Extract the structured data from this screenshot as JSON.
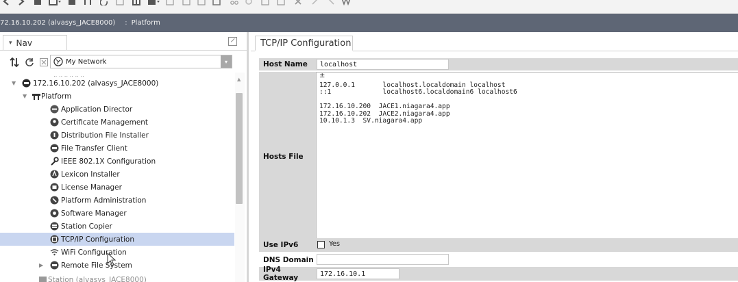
{
  "toolbar": {
    "icons": [
      "back-arrow-icon",
      "forward-arrow-icon",
      "home-icon",
      "grid-dropdown-icon",
      "save-icon",
      "hierarchy-icon",
      "refresh-icon",
      "history-icon",
      "table-icon",
      "menu-dropdown-icon",
      "blank-page-icon",
      "copy-icon",
      "paste-icon",
      "edit-icon",
      "cut-icon",
      "undo-icon",
      "new-icon",
      "duplicate-icon",
      "delete-icon",
      "redo-icon",
      "pointer-icon",
      "wand-icon"
    ]
  },
  "pathbar": {
    "host": "72.16.10.202 (alvasys_JACE8000)",
    "separator": ":",
    "section": "Platform"
  },
  "nav": {
    "title": "Nav",
    "network_select": "My Network",
    "tree": [
      {
        "label": "172.16.10.202 (alvasys_JACE8000)",
        "icon": "server-icon",
        "level": 0,
        "expanded": true
      },
      {
        "label": "Platform",
        "icon": "platform-icon",
        "level": 1,
        "expanded": true
      },
      {
        "label": "Application Director",
        "icon": "application-director-icon",
        "level": 2
      },
      {
        "label": "Certificate Management",
        "icon": "certificate-icon",
        "level": 2
      },
      {
        "label": "Distribution File Installer",
        "icon": "distribution-installer-icon",
        "level": 2
      },
      {
        "label": "File Transfer Client",
        "icon": "file-transfer-icon",
        "level": 2
      },
      {
        "label": "IEEE 802.1X Configuration",
        "icon": "wrench-icon",
        "level": 2
      },
      {
        "label": "Lexicon Installer",
        "icon": "lexicon-icon",
        "level": 2
      },
      {
        "label": "License Manager",
        "icon": "license-icon",
        "level": 2
      },
      {
        "label": "Platform Administration",
        "icon": "platform-admin-icon",
        "level": 2
      },
      {
        "label": "Software Manager",
        "icon": "software-manager-icon",
        "level": 2
      },
      {
        "label": "Station Copier",
        "icon": "station-copier-icon",
        "level": 2
      },
      {
        "label": "TCP/IP Configuration",
        "icon": "tcpip-icon",
        "level": 2,
        "selected": true
      },
      {
        "label": "WiFi Configuration",
        "icon": "wifi-icon",
        "level": 2
      },
      {
        "label": "Remote File System",
        "icon": "remote-fs-icon",
        "level": 2,
        "collapsed": true
      },
      {
        "label": "Station (alvasys_JACE8000)",
        "icon": "station-icon",
        "level": 1
      }
    ]
  },
  "tcpip": {
    "tab_title": "TCP/IP Configuration",
    "host_name_label": "Host Name",
    "host_name_value": "localhost",
    "hosts_file_label": "Hosts File",
    "hosts_file_lines": [
      "127.0.0.1       localhost.localdomain localhost",
      "::1             localhost6.localdomain6 localhost6",
      "",
      "172.16.10.200  JACE1.niagara4.app",
      "172.16.10.202  JACE2.niagara4.app",
      "10.10.1.3  SV.niagara4.app"
    ],
    "use_ipv6_label": "Use IPv6",
    "use_ipv6_option": "Yes",
    "use_ipv6_checked": false,
    "dns_domain_label": "DNS Domain",
    "dns_domain_value": "",
    "ipv4_gateway_label": "IPv4 Gateway",
    "ipv4_gateway_value": "172.16.10.1"
  },
  "colors": {
    "pathbar_bg": "#5e6675",
    "selection_bg": "#c9d6f0",
    "row_grey": "#d8d8d8"
  }
}
